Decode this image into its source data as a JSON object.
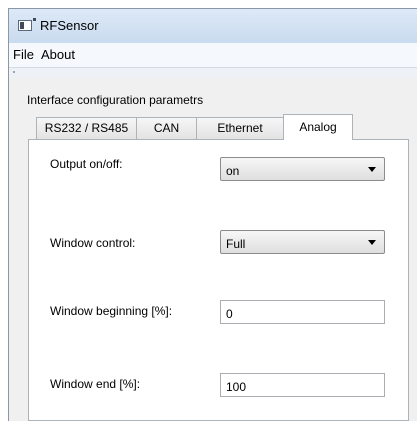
{
  "window": {
    "title": "RFSensor",
    "app_icon": "app-window-icon"
  },
  "menubar": {
    "items": [
      {
        "label": "File"
      },
      {
        "label": "About"
      }
    ]
  },
  "group": {
    "label": "Interface configuration parametrs"
  },
  "tabs": [
    {
      "label": "RS232 / RS485",
      "active": false
    },
    {
      "label": "CAN",
      "active": false
    },
    {
      "label": "Ethernet",
      "active": false
    },
    {
      "label": "Analog",
      "active": true
    }
  ],
  "analog": {
    "output": {
      "label": "Output on/off:",
      "value": "on",
      "icon": "chevron-down-icon"
    },
    "window_control": {
      "label": "Window control:",
      "value": "Full",
      "icon": "chevron-down-icon"
    },
    "window_beginning": {
      "label": "Window beginning [%]:",
      "value": "0"
    },
    "window_end": {
      "label": "Window end [%]:",
      "value": "100"
    }
  }
}
